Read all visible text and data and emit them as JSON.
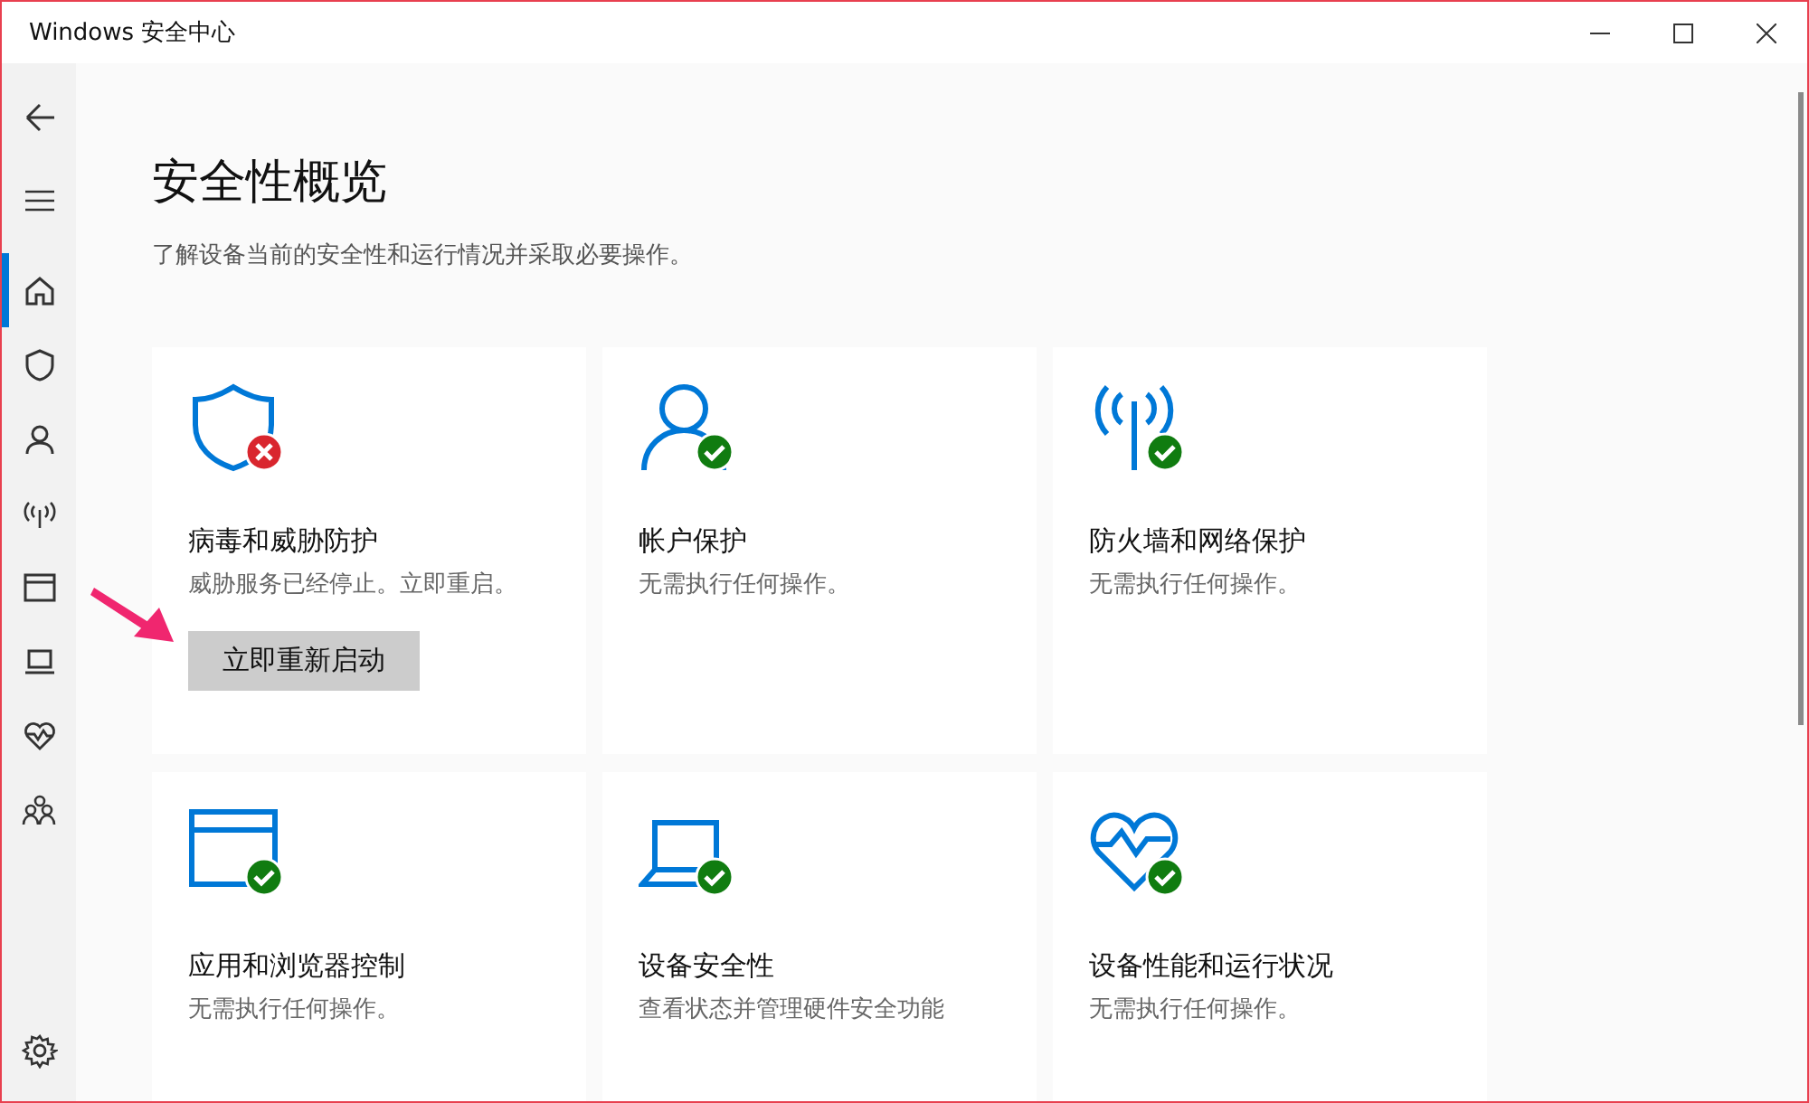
{
  "window": {
    "title": "Windows 安全中心"
  },
  "nav": [
    {
      "kind": "back",
      "selected": false
    },
    {
      "kind": "menu",
      "selected": false
    },
    {
      "kind": "home",
      "selected": true
    },
    {
      "kind": "shield",
      "selected": false
    },
    {
      "kind": "person",
      "selected": false
    },
    {
      "kind": "antenna",
      "selected": false
    },
    {
      "kind": "browser",
      "selected": false
    },
    {
      "kind": "laptop",
      "selected": false
    },
    {
      "kind": "heart",
      "selected": false
    },
    {
      "kind": "family",
      "selected": false
    }
  ],
  "settings": {
    "kind": "gear"
  },
  "page": {
    "heading": "安全性概览",
    "subtitle": "了解设备当前的安全性和运行情况并采取必要操作。"
  },
  "cards": [
    {
      "kind": "shield",
      "alert": true,
      "title": "病毒和威胁防护",
      "description": "威胁服务已经停止。立即重启。",
      "button": "立即重新启动"
    },
    {
      "kind": "person",
      "alert": false,
      "title": "帐户保护",
      "description": "无需执行任何操作。"
    },
    {
      "kind": "antenna",
      "alert": false,
      "title": "防火墙和网络保护",
      "description": "无需执行任何操作。"
    },
    {
      "kind": "browser",
      "alert": false,
      "title": "应用和浏览器控制",
      "description": "无需执行任何操作。"
    },
    {
      "kind": "laptop",
      "alert": false,
      "title": "设备安全性",
      "description": "查看状态并管理硬件安全功能"
    },
    {
      "kind": "heart",
      "alert": false,
      "title": "设备性能和运行状况",
      "description": "无需执行任何操作。"
    }
  ]
}
